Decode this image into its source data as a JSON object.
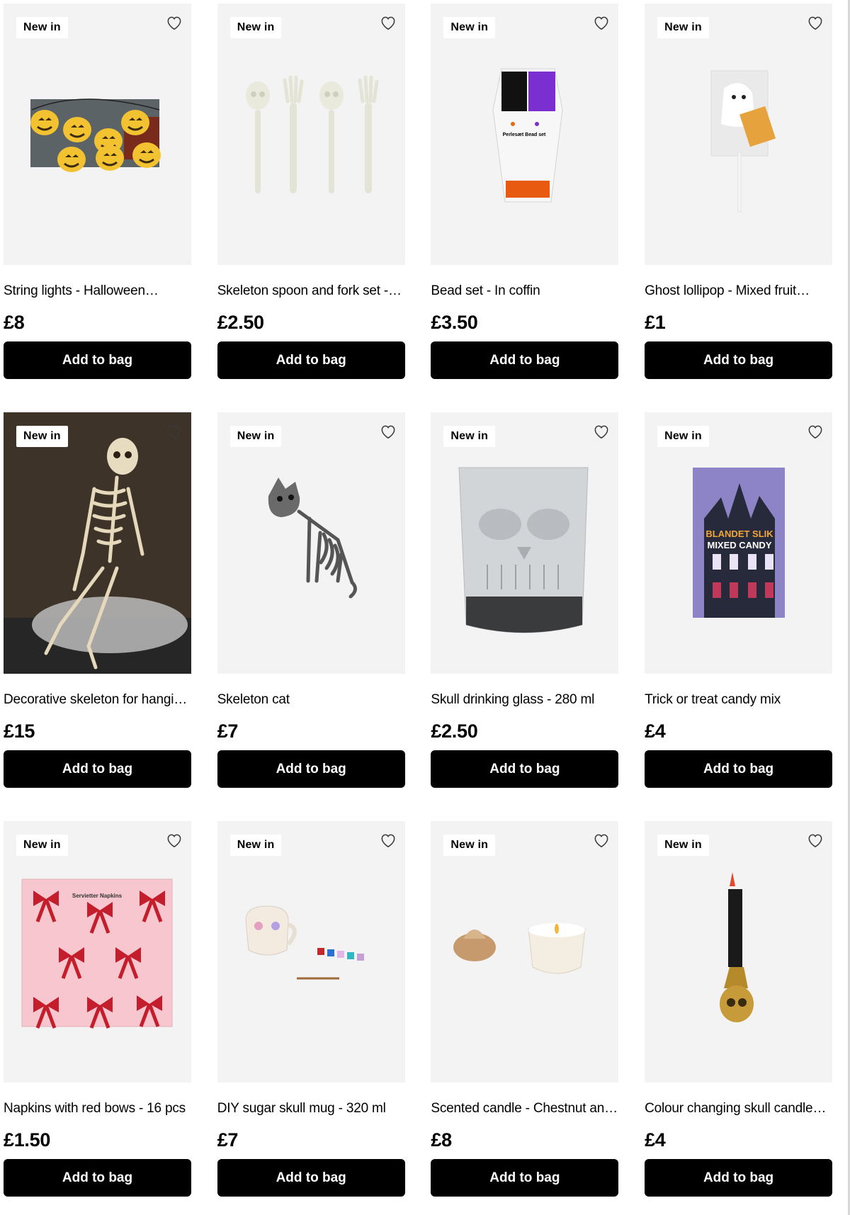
{
  "badge_label": "New in",
  "button_label": "Add to bag",
  "products": [
    {
      "name": "String lights - Halloween…",
      "price": "£8",
      "art": "pumpkin-string-lights"
    },
    {
      "name": "Skeleton spoon and fork set - …",
      "price": "£2.50",
      "art": "skeleton-cutlery"
    },
    {
      "name": "Bead set - In coffin",
      "price": "£3.50",
      "art": "coffin-bead-set",
      "packaging_text": "Perlesæt Bead set"
    },
    {
      "name": "Ghost lollipop - Mixed fruit…",
      "price": "£1",
      "art": "ghost-lollipop"
    },
    {
      "name": "Decorative skeleton for hangi…",
      "price": "£15",
      "art": "hanging-skeleton"
    },
    {
      "name": "Skeleton cat",
      "price": "£7",
      "art": "skeleton-cat"
    },
    {
      "name": "Skull drinking glass - 280 ml",
      "price": "£2.50",
      "art": "skull-glass"
    },
    {
      "name": "Trick or treat candy mix",
      "price": "£4",
      "art": "haunted-house-candy",
      "packaging_text": "BLANDET SLIK MIXED CANDY"
    },
    {
      "name": "Napkins with red bows - 16 pcs",
      "price": "£1.50",
      "art": "bow-napkins",
      "packaging_text": "Servietter Napkins"
    },
    {
      "name": "DIY sugar skull mug - 320 ml",
      "price": "£7",
      "art": "sugar-skull-mug"
    },
    {
      "name": "Scented candle - Chestnut an…",
      "price": "£8",
      "art": "chestnut-candle"
    },
    {
      "name": "Colour changing skull candle…",
      "price": "£4",
      "art": "skull-candle"
    }
  ],
  "colors": {
    "button_bg": "#000000",
    "image_bg": "#f3f3f3",
    "text": "#000000"
  }
}
